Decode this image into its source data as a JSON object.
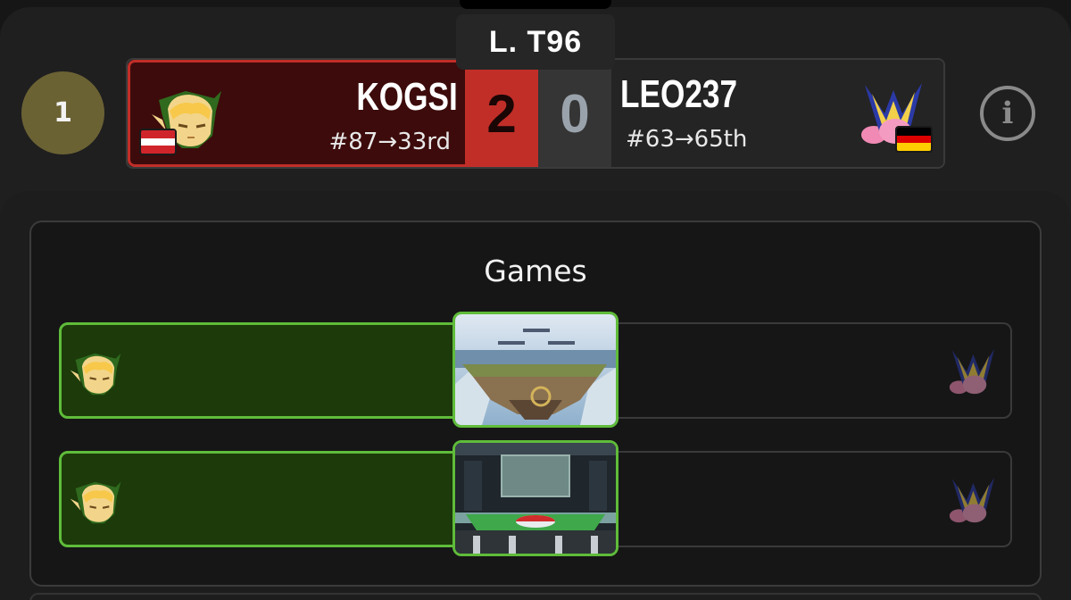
{
  "header": {
    "round_number": "1",
    "round_label": "L. T96",
    "info_icon": "info-circle-icon"
  },
  "match": {
    "left_player": {
      "name": "KOGSI",
      "rank": "#87→33rd",
      "score": "2",
      "character_icon": "young-link-icon",
      "flag": "austria-flag",
      "accent_color": "#c12e28"
    },
    "right_player": {
      "name": "LEO237",
      "rank": "#63→65th",
      "score": "0",
      "character_icon": "meta-knight-icon",
      "flag": "germany-flag"
    }
  },
  "games": {
    "title": "Games",
    "rows": [
      {
        "winner": "left",
        "left_icon": "young-link-icon",
        "right_icon": "meta-knight-icon",
        "stage_icon": "battlefield-stage-icon"
      },
      {
        "winner": "left",
        "left_icon": "young-link-icon",
        "right_icon": "meta-knight-icon",
        "stage_icon": "pokemon-stadium-stage-icon"
      }
    ],
    "win_color": "#5fbc3a"
  }
}
